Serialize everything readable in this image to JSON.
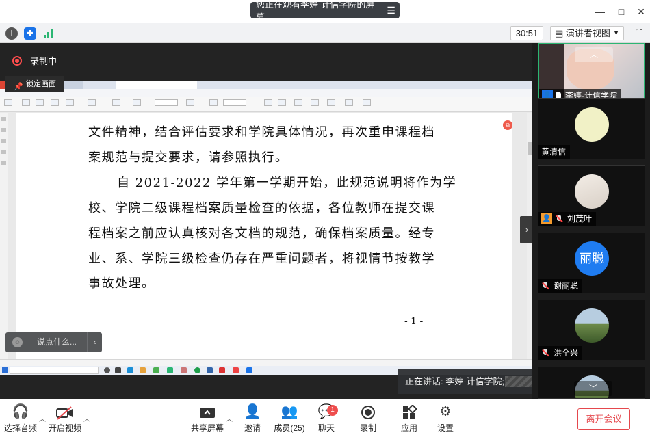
{
  "share_banner": {
    "text": "您正在观看李婷-计信学院的屏幕",
    "menu_icon": "menu-icon"
  },
  "window_controls": {
    "minimize": "—",
    "maximize": "□",
    "close": "✕"
  },
  "infobar": {
    "timer": "30:51",
    "view_mode": "演讲者视图",
    "info_icon": "i"
  },
  "recording": {
    "label": "录制中"
  },
  "lock_screen": {
    "label": "锁定画面"
  },
  "document": {
    "lines": [
      "文件精神，结合评估要求和学院具体情况，再次重申课程档",
      "案规范与提交要求，请参照执行。",
      "自 2021-2022 学年第一学期开始，此规范说明将作为学",
      "校、学院二级课程档案质量检查的依据，各位教师在提交课",
      "程档案之前应认真核对各文档的规范，确保档案质量。经专",
      "业、系、学院三级检查仍存在严重问题者，将视情节按教学",
      "事故处理。"
    ],
    "page_number": "- 1 -"
  },
  "chat": {
    "placeholder": "说点什么..."
  },
  "speaking": {
    "label": "正在讲话: 李婷-计信学院;"
  },
  "participants": [
    {
      "name": "李婷-计信学院",
      "video": true
    },
    {
      "name": "黄清信"
    },
    {
      "name": "刘茂叶"
    },
    {
      "name": "谢丽聪",
      "avatar_text": "丽聪"
    },
    {
      "name": "洪全兴"
    },
    {
      "name": ""
    }
  ],
  "toolbar": {
    "audio": "选择音频",
    "video": "开启视频",
    "share": "共享屏幕",
    "invite": "邀请",
    "members": "成员(25)",
    "chat": "聊天",
    "chat_badge": "1",
    "record": "录制",
    "apps": "应用",
    "settings": "设置",
    "leave": "离开会议"
  },
  "colors": {
    "accent": "#1a73e8",
    "danger": "#e5484d",
    "active_border": "#2bb673"
  }
}
